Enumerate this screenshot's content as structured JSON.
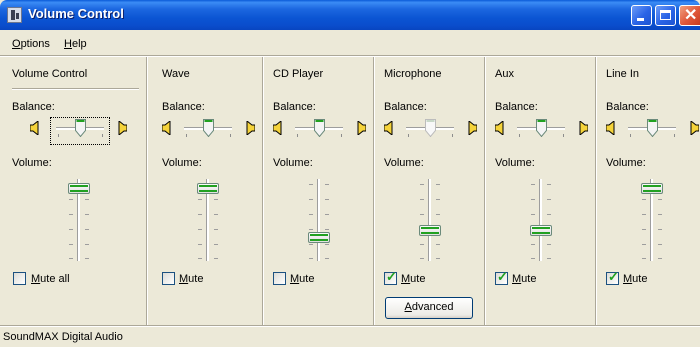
{
  "window": {
    "title": "Volume Control"
  },
  "menu": {
    "options": {
      "first": "O",
      "rest": "ptions"
    },
    "help": {
      "first": "H",
      "rest": "elp"
    }
  },
  "channels": [
    {
      "title": "Volume Control",
      "balance_label": "Balance:",
      "volume_label": "Volume:",
      "balance_level": 0.5,
      "volume_level": 0.95,
      "mute_first": "M",
      "mute_rest": "ute all",
      "muted": false
    },
    {
      "title": "Wave",
      "balance_label": "Balance:",
      "volume_label": "Volume:",
      "balance_level": 0.5,
      "volume_level": 0.95,
      "mute_first": "M",
      "mute_rest": "ute",
      "muted": false
    },
    {
      "title": "CD Player",
      "balance_label": "Balance:",
      "volume_label": "Volume:",
      "balance_level": 0.5,
      "volume_level": 0.25,
      "mute_first": "M",
      "mute_rest": "ute",
      "muted": false
    },
    {
      "title": "Microphone",
      "balance_label": "Balance:",
      "volume_label": "Volume:",
      "balance_level": 0.5,
      "volume_level": 0.35,
      "mute_first": "M",
      "mute_rest": "ute",
      "muted": true,
      "advanced_label_first": "A",
      "advanced_label_rest": "dvanced"
    },
    {
      "title": "Aux",
      "balance_label": "Balance:",
      "volume_label": "Volume:",
      "balance_level": 0.5,
      "volume_level": 0.35,
      "mute_first": "M",
      "mute_rest": "ute",
      "muted": true
    },
    {
      "title": "Line In",
      "balance_label": "Balance:",
      "volume_label": "Volume:",
      "balance_level": 0.5,
      "volume_level": 0.95,
      "mute_first": "M",
      "mute_rest": "ute",
      "muted": true
    }
  ],
  "status_bar": {
    "text": "SoundMAX Digital Audio"
  },
  "colors": {
    "titlebar": "#0a55d3",
    "face": "#ece9d8",
    "thumb_accent": "#21a121"
  }
}
